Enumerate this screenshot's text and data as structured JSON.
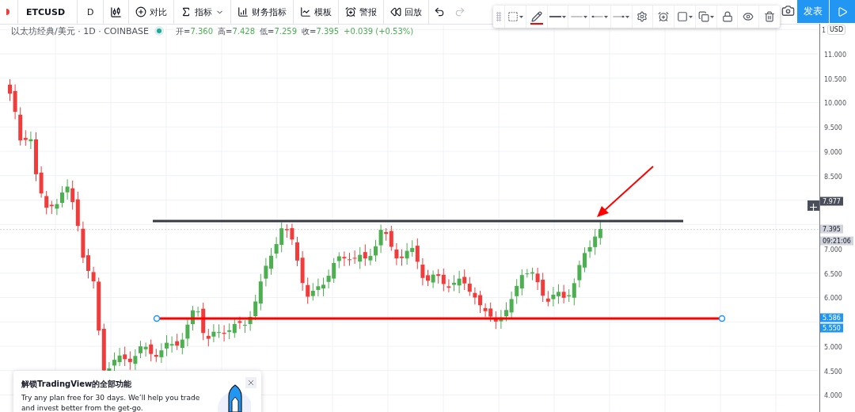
{
  "toolbar": {
    "symbol": "ETCUSD",
    "interval": "D",
    "buttons": [
      {
        "label": "对比",
        "kind": "compare"
      },
      {
        "label": "指标",
        "kind": "indicators"
      },
      {
        "label": "财务指标",
        "kind": "financials"
      },
      {
        "label": "模板",
        "kind": "templates"
      },
      {
        "label": "警报",
        "kind": "alert"
      },
      {
        "label": "回放",
        "kind": "replay"
      }
    ],
    "publish": "发表"
  },
  "legend": {
    "title": "以太坊经典/美元 · 1D · COINBASE",
    "values": [
      {
        "label": "开=",
        "value": "7.360"
      },
      {
        "label": "高=",
        "value": "7.428"
      },
      {
        "label": "低=",
        "value": "7.259"
      },
      {
        "label": "收=",
        "value": "7.395"
      }
    ],
    "change": "+0.039 (+0.53%)"
  },
  "drawing_toolbar": {
    "tools": [
      {
        "kind": "area",
        "menu": true
      },
      {
        "kind": "pencil",
        "menu": false
      },
      {
        "kind": "width",
        "menu": true
      },
      {
        "kind": "style",
        "menu": true
      },
      {
        "kind": "left-end",
        "menu": true
      },
      {
        "kind": "right-end",
        "menu": true
      },
      {
        "kind": "settings",
        "menu": false
      },
      {
        "kind": "alert",
        "menu": false
      },
      {
        "kind": "fill",
        "menu": true
      },
      {
        "kind": "clone",
        "menu": true
      },
      {
        "kind": "lock",
        "menu": false
      },
      {
        "kind": "visibility",
        "menu": false
      },
      {
        "kind": "delete",
        "menu": false
      }
    ]
  },
  "price_axis": {
    "currency": "USD",
    "ticks": [
      "1",
      "11.000",
      "10.500",
      "10.000",
      "9.500",
      "9.000",
      "8.500",
      "7.000",
      "6.500",
      "6.000",
      "5.000",
      "4.500",
      "4.000"
    ],
    "tags": [
      {
        "label": "7.977",
        "kind": "crosshair"
      },
      {
        "label": "7.395",
        "kind": "last"
      },
      {
        "label": "09:21:06",
        "kind": "countdown"
      },
      {
        "label": "5.586",
        "kind": "level"
      },
      {
        "label": "5.550",
        "kind": "level"
      }
    ]
  },
  "banner": {
    "title": "解锁TradingView的全部功能",
    "text": "Try any plan free for 30 days. We’ll help you trade and invest better from the get-go."
  }
}
